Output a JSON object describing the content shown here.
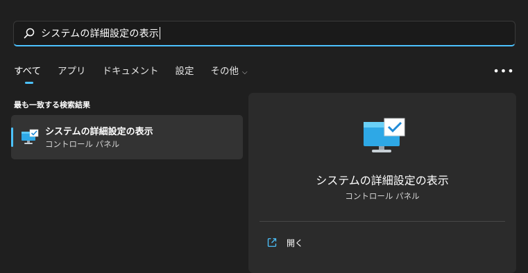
{
  "search": {
    "value": "システムの詳細設定の表示",
    "icon": "search-icon"
  },
  "tabs": [
    {
      "label": "すべて",
      "active": true
    },
    {
      "label": "アプリ",
      "active": false
    },
    {
      "label": "ドキュメント",
      "active": false
    },
    {
      "label": "設定",
      "active": false
    },
    {
      "label": "その他",
      "active": false
    }
  ],
  "more_button": {
    "label": "•••"
  },
  "best_match": {
    "heading": "最も一致する検索結果",
    "item": {
      "title": "システムの詳細設定の表示",
      "subtitle": "コントロール パネル",
      "icon": "system-settings-icon"
    }
  },
  "detail": {
    "title": "システムの詳細設定の表示",
    "subtitle": "コントロール パネル",
    "icon": "system-settings-icon",
    "actions": [
      {
        "label": "開く",
        "icon": "open-external-icon"
      }
    ]
  },
  "colors": {
    "accent": "#4cc2ff",
    "background": "#1f1f1f",
    "panel": "#2b2b2b",
    "selected_item": "#333333"
  }
}
